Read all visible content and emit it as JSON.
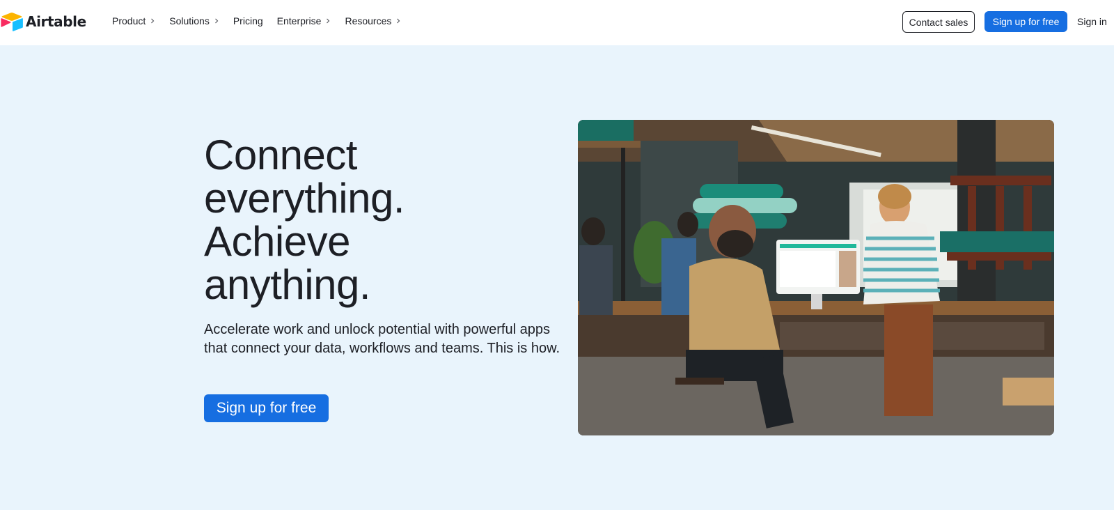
{
  "brand": {
    "name": "Airtable",
    "icon": "airtable-logo-icon",
    "colors": {
      "yellow": "#fcb400",
      "red": "#f82b60",
      "blue": "#18bfff",
      "dark_blue": "#2d7ff9"
    }
  },
  "nav": {
    "items": [
      {
        "label": "Product",
        "has_chevron": true
      },
      {
        "label": "Solutions",
        "has_chevron": true
      },
      {
        "label": "Pricing",
        "has_chevron": false
      },
      {
        "label": "Enterprise",
        "has_chevron": true
      },
      {
        "label": "Resources",
        "has_chevron": true
      }
    ],
    "chevron_icon": "chevron-right-icon"
  },
  "header_actions": {
    "contact_label": "Contact sales",
    "signup_label": "Sign up for free",
    "signin_label": "Sign in"
  },
  "hero": {
    "headline_lines": [
      "Connect",
      "everything.",
      "Achieve",
      "anything."
    ],
    "subhead": "Accelerate work and unlock potential with powerful apps that connect your data, workflows and teams. This is how.",
    "cta_label": "Sign up for free",
    "image_subject": "hero-photo-workshop"
  },
  "colors": {
    "accent": "#166ee1",
    "page_background": "#e9f4fc",
    "header_background": "#ffffff",
    "text": "#1d1f25"
  }
}
